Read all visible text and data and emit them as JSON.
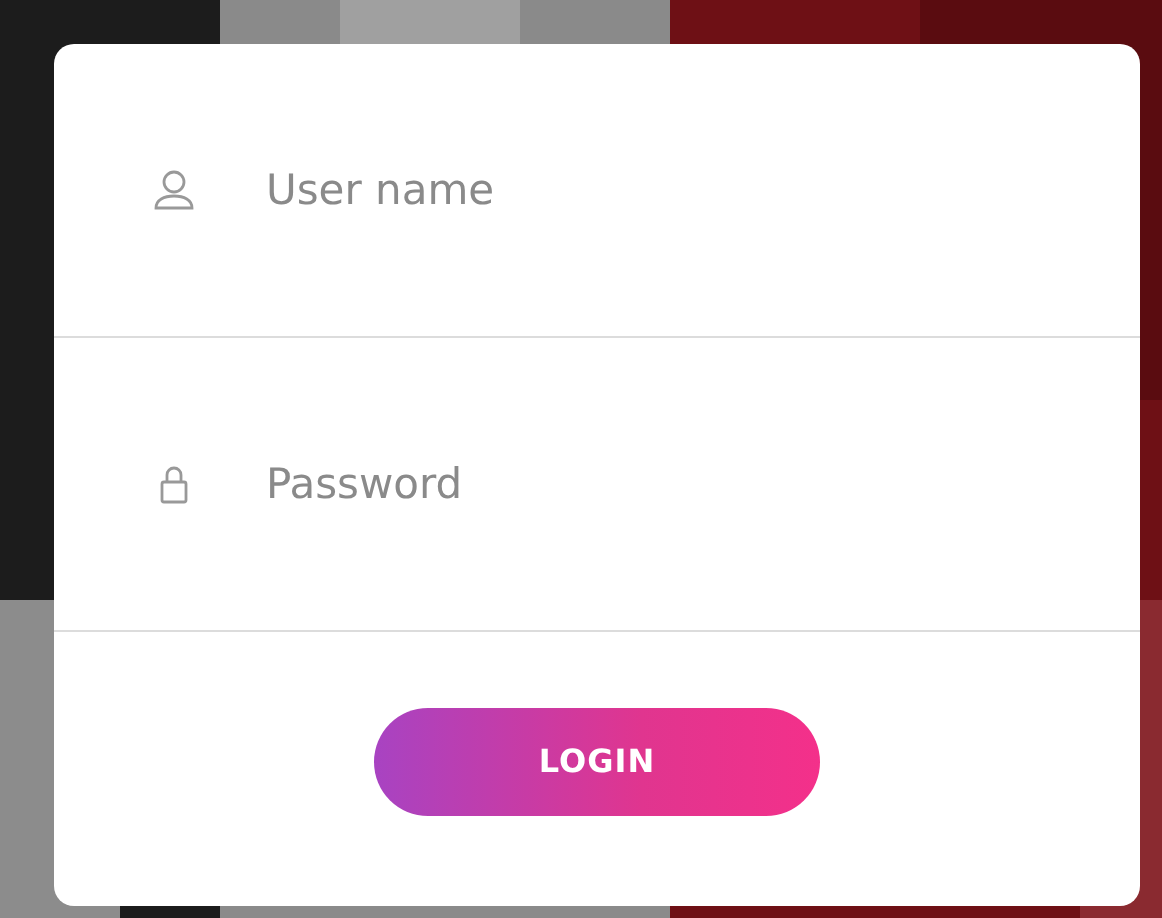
{
  "fields": [
    {
      "kind": "user",
      "placeholder": "User name"
    },
    {
      "kind": "password",
      "placeholder": "Password"
    }
  ],
  "button": {
    "label": "LOGIN"
  }
}
